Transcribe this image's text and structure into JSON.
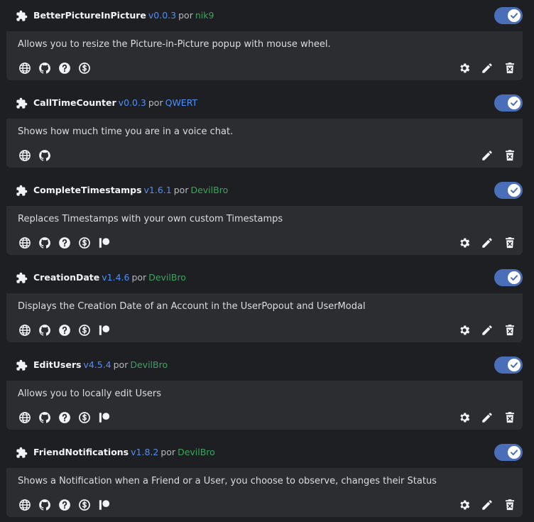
{
  "plugins": [
    {
      "name": "BetterPictureInPicture",
      "version": "v0.0.3",
      "by": "por",
      "author": "nik9",
      "author_color": "#3ba55d",
      "description": "Allows you to resize the Picture-in-Picture popup with mouse wheel.",
      "enabled": true,
      "links": [
        "website-icon",
        "github-icon",
        "help-icon",
        "donate-icon"
      ],
      "actions": [
        "settings-icon",
        "edit-icon",
        "delete-icon"
      ]
    },
    {
      "name": "CallTimeCounter",
      "version": "v0.0.3",
      "by": "por",
      "author": "QWERT",
      "author_color": "#4f8ff7",
      "description": "Shows how much time you are in a voice chat.",
      "enabled": true,
      "links": [
        "website-icon",
        "github-icon"
      ],
      "actions": [
        "edit-icon",
        "delete-icon"
      ]
    },
    {
      "name": "CompleteTimestamps",
      "version": "v1.6.1",
      "by": "por",
      "author": "DevilBro",
      "author_color": "#3ba55d",
      "description": "Replaces Timestamps with your own custom Timestamps",
      "enabled": true,
      "links": [
        "website-icon",
        "github-icon",
        "help-icon",
        "donate-icon",
        "patreon-icon"
      ],
      "actions": [
        "settings-icon",
        "edit-icon",
        "delete-icon"
      ]
    },
    {
      "name": "CreationDate",
      "version": "v1.4.6",
      "by": "por",
      "author": "DevilBro",
      "author_color": "#3ba55d",
      "description": "Displays the Creation Date of an Account in the UserPopout and UserModal",
      "enabled": true,
      "links": [
        "website-icon",
        "github-icon",
        "help-icon",
        "donate-icon",
        "patreon-icon"
      ],
      "actions": [
        "settings-icon",
        "edit-icon",
        "delete-icon"
      ]
    },
    {
      "name": "EditUsers",
      "version": "v4.5.4",
      "by": "por",
      "author": "DevilBro",
      "author_color": "#3ba55d",
      "description": "Allows you to locally edit Users",
      "enabled": true,
      "links": [
        "website-icon",
        "github-icon",
        "help-icon",
        "donate-icon",
        "patreon-icon"
      ],
      "actions": [
        "settings-icon",
        "edit-icon",
        "delete-icon"
      ]
    },
    {
      "name": "FriendNotifications",
      "version": "v1.8.2",
      "by": "por",
      "author": "DevilBro",
      "author_color": "#3ba55d",
      "description": "Shows a Notification when a Friend or a User, you choose to observe, changes their Status",
      "enabled": true,
      "links": [
        "website-icon",
        "github-icon",
        "help-icon",
        "donate-icon",
        "patreon-icon"
      ],
      "actions": [
        "settings-icon",
        "edit-icon",
        "delete-icon"
      ]
    }
  ]
}
